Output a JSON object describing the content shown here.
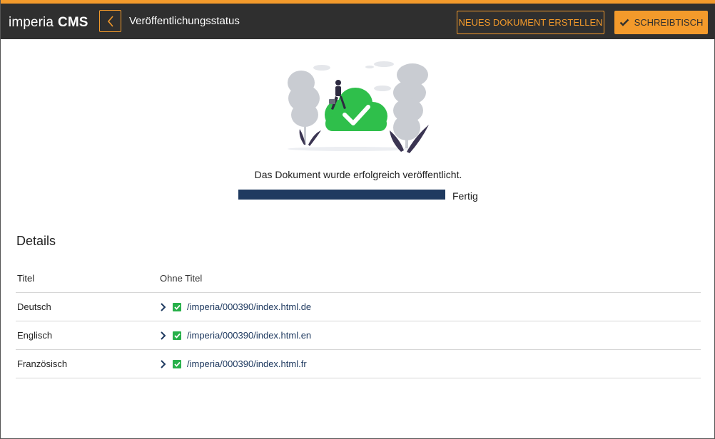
{
  "header": {
    "logo_a": "imperia",
    "logo_b": "CMS",
    "title": "Veröffentlichungsstatus",
    "new_document_label": "NEUES DOKUMENT ERSTELLEN",
    "desk_label": "SCHREIBTISCH",
    "accent_color": "#f39a2b"
  },
  "status": {
    "message": "Das Dokument wurde erfolgreich veröffentlicht.",
    "progress_fraction": 1.0,
    "progress_label": "Fertig"
  },
  "details": {
    "title": "Details",
    "rows": [
      {
        "label": "Titel",
        "value": "Ohne Titel"
      },
      {
        "label": "Deutsch",
        "link": "/imperia/000390/index.html.de"
      },
      {
        "label": "Englisch",
        "link": "/imperia/000390/index.html.en"
      },
      {
        "label": "Französisch",
        "link": "/imperia/000390/index.html.fr"
      }
    ]
  }
}
